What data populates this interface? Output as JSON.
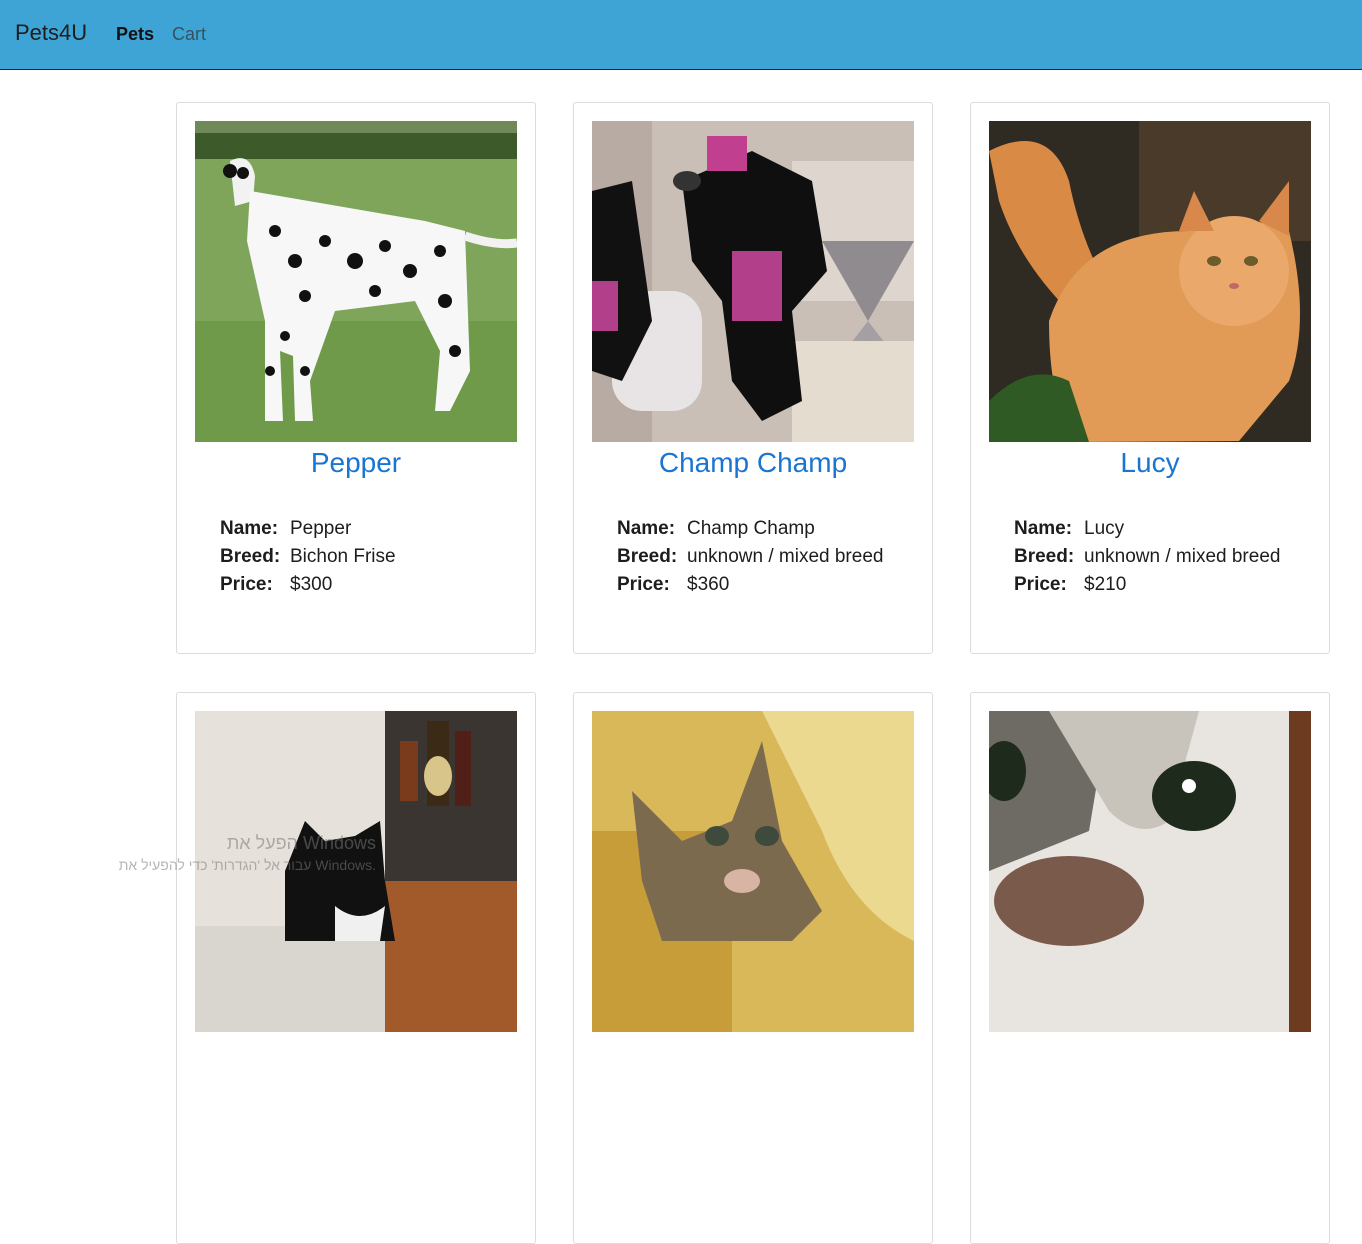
{
  "navbar": {
    "brand": "Pets4U",
    "links": [
      {
        "label": "Pets",
        "active": true
      },
      {
        "label": "Cart",
        "active": false
      }
    ],
    "background_color": "#3ea4d5"
  },
  "labels": {
    "name": "Name:",
    "breed": "Breed:",
    "price": "Price:"
  },
  "pets": [
    {
      "title": "Pepper",
      "name": "Pepper",
      "breed": "Bichon Frise",
      "price": "$300",
      "photo": "dalmatian-photo"
    },
    {
      "title": "Champ Champ",
      "name": "Champ Champ",
      "breed": "unknown / mixed breed",
      "price": "$360",
      "photo": "plush-toy-photo"
    },
    {
      "title": "Lucy",
      "name": "Lucy",
      "breed": "unknown / mixed breed",
      "price": "$210",
      "photo": "orange-cat-photo"
    },
    {
      "photo": "tuxedo-cat-photo"
    },
    {
      "photo": "tabby-kitten-photo"
    },
    {
      "photo": "closeup-cat-photo"
    }
  ],
  "watermark": {
    "line1": "הפעל את Windows",
    "line2": "עבור אל 'הגדרות' כדי להפעיל את Windows."
  },
  "colors": {
    "link": "#1a75d2",
    "card_border": "#dcdcdc"
  }
}
